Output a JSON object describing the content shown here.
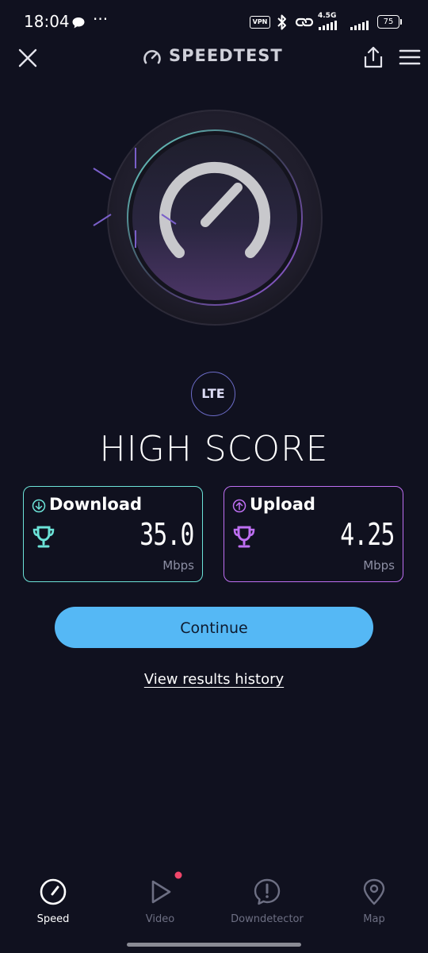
{
  "status_bar": {
    "time": "18:04",
    "overflow_dots": "···",
    "vpn": "VPN",
    "network": "4.5G",
    "battery": "75"
  },
  "header": {
    "title": "SPEEDTEST",
    "icons": [
      "close-icon",
      "speedtest-logo-icon",
      "share-icon",
      "menu-icon"
    ]
  },
  "gauge": {
    "icon": "speedometer-icon"
  },
  "result": {
    "connection_type": "LTE",
    "headline": "HIGH SCORE",
    "download": {
      "label": "Download",
      "value": "35.0",
      "unit": "Mbps",
      "accent_color": "#6ce3d8",
      "icons": [
        "download-arrow-icon",
        "trophy-icon"
      ]
    },
    "upload": {
      "label": "Upload",
      "value": "4.25",
      "unit": "Mbps",
      "accent_color": "#be6ff2",
      "icons": [
        "upload-arrow-icon",
        "trophy-icon"
      ]
    }
  },
  "actions": {
    "continue_label": "Continue",
    "history_label": "View results history",
    "button_color": "#55b8f5"
  },
  "bottom_nav": {
    "items": [
      {
        "label": "Speed",
        "icon": "speedometer-icon",
        "active": true
      },
      {
        "label": "Video",
        "icon": "play-icon",
        "badge": true
      },
      {
        "label": "Downdetector",
        "icon": "alert-bubble-icon"
      },
      {
        "label": "Map",
        "icon": "map-pin-icon"
      }
    ]
  }
}
